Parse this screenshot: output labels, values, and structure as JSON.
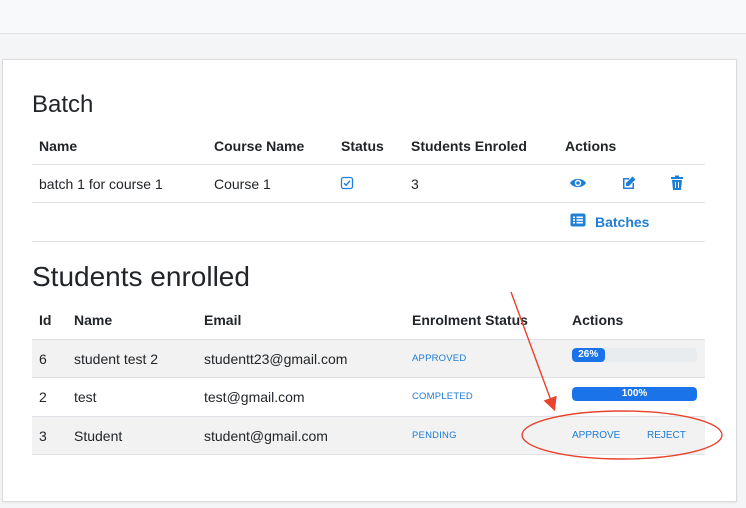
{
  "batch": {
    "heading": "Batch",
    "headers": {
      "name": "Name",
      "course": "Course Name",
      "status": "Status",
      "students": "Students Enroled",
      "actions": "Actions"
    },
    "row": {
      "name": "batch 1 for course 1",
      "course": "Course 1",
      "students": "3"
    },
    "batches_link": "Batches"
  },
  "students": {
    "heading": "Students enrolled",
    "headers": {
      "id": "Id",
      "name": "Name",
      "email": "Email",
      "status": "Enrolment Status",
      "actions": "Actions"
    },
    "rows": [
      {
        "id": "6",
        "name": "student test 2",
        "email": "studentt23@gmail.com",
        "status": "APPROVED",
        "progress": 26,
        "progress_label": "26%"
      },
      {
        "id": "2",
        "name": "test",
        "email": "test@gmail.com",
        "status": "COMPLETED",
        "progress": 100,
        "progress_label": "100%"
      },
      {
        "id": "3",
        "name": "Student",
        "email": "student@gmail.com",
        "status": "PENDING",
        "approve": "APPROVE",
        "reject": "REJECT"
      }
    ]
  },
  "colors": {
    "accent": "#1f7fd6",
    "progress": "#1a73e8",
    "annotation": "#e8432d"
  },
  "icons": [
    "eye-icon",
    "edit-icon",
    "trash-icon",
    "list-icon",
    "checkbox-icon"
  ]
}
